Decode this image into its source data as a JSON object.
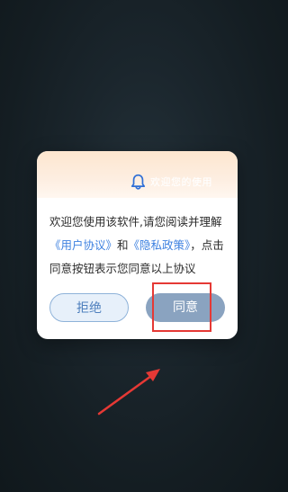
{
  "dialog": {
    "title": "欢迎您的使用",
    "message_prefix": "欢迎您使用该软件,请您阅读并理解",
    "user_agreement_link": "《用户协议》",
    "conjunction": "和",
    "privacy_policy_link": "《隐私政策》",
    "message_suffix": "，点击同意按钮表示您同意以上协议",
    "reject_label": "拒绝",
    "agree_label": "同意"
  },
  "colors": {
    "link": "#3f82e0",
    "agree_button": "#8aa3c0",
    "reject_button_bg": "#e7f0fa",
    "highlight": "#e53935",
    "bell_icon": "#2f6fd6"
  },
  "icons": {
    "header": "bell-icon"
  },
  "annotations": {
    "highlight_target": "agree-button",
    "arrow": "red-arrow-icon"
  }
}
